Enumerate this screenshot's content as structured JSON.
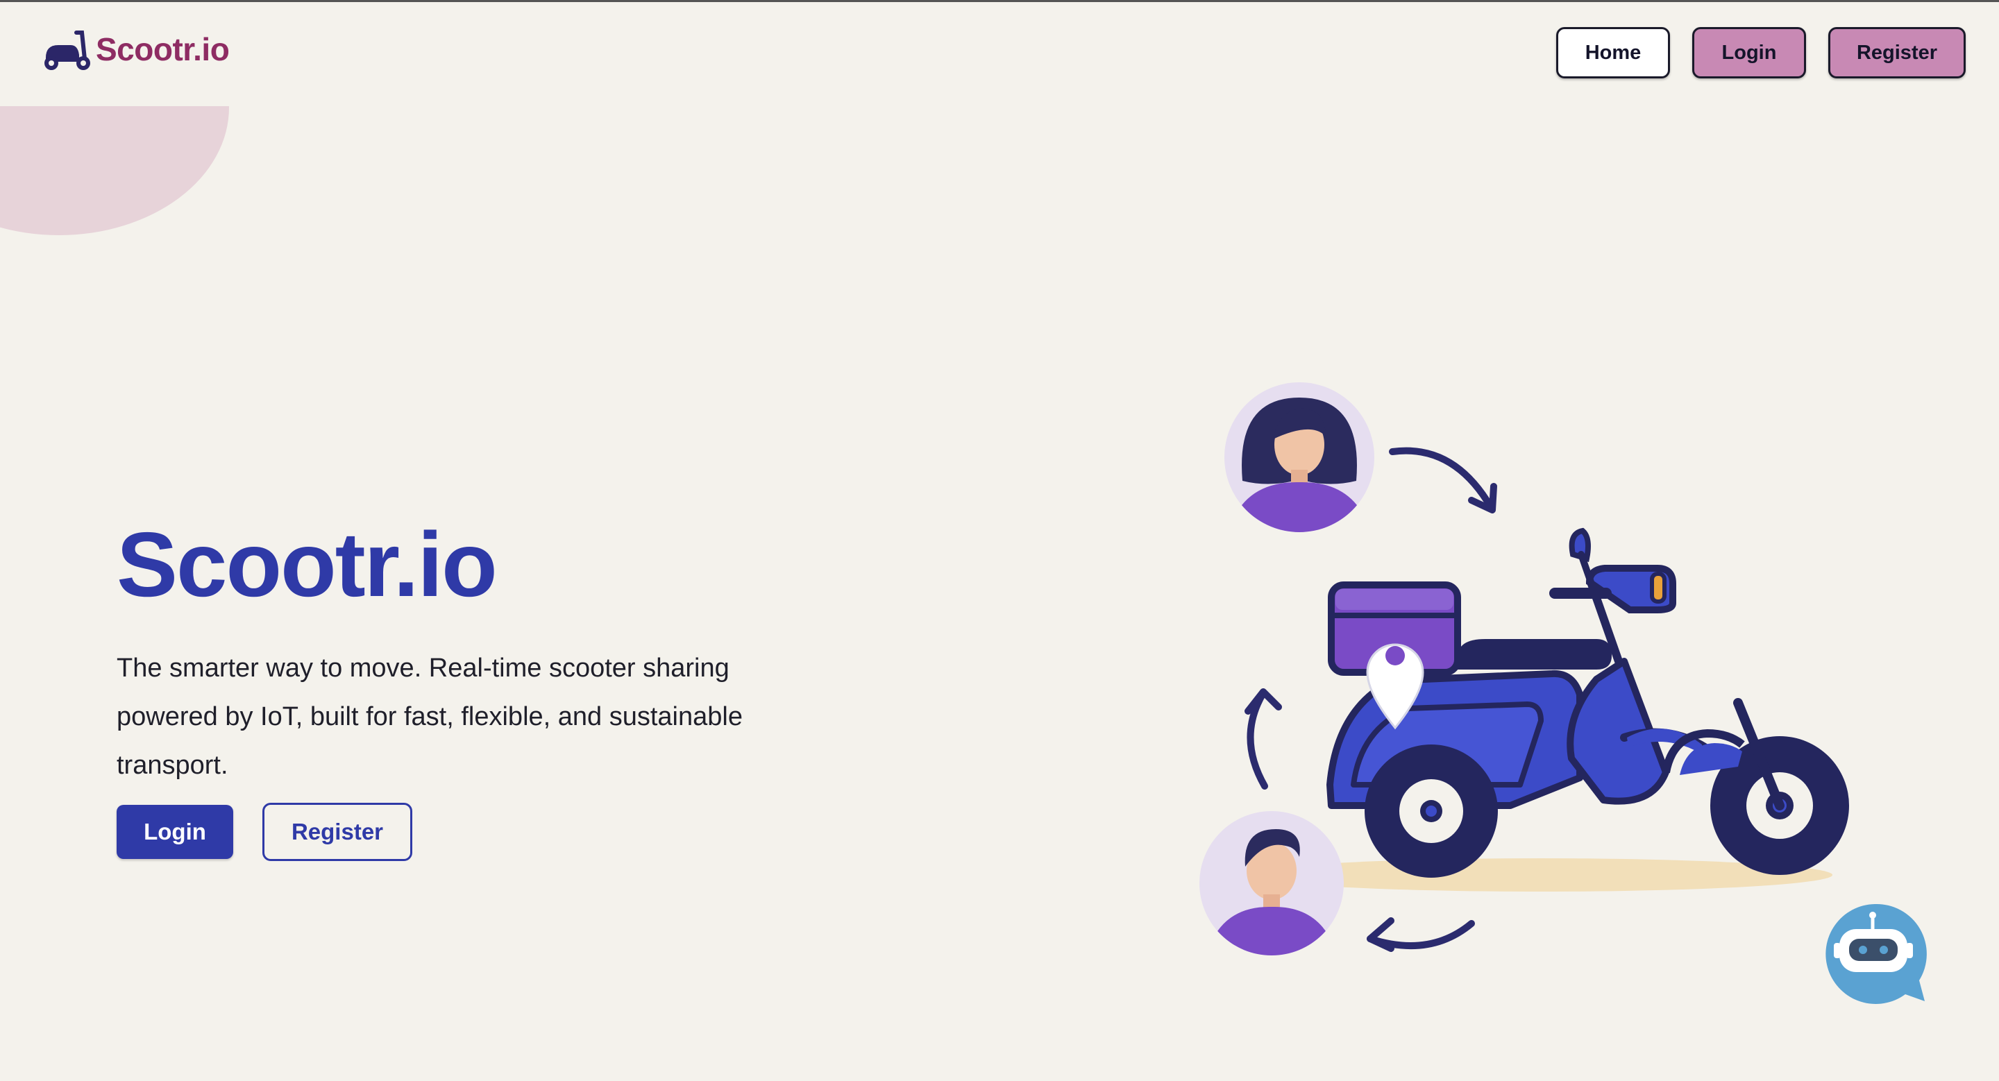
{
  "app": {
    "brand_name": "Scootr.io"
  },
  "nav": {
    "home_label": "Home",
    "login_label": "Login",
    "register_label": "Register"
  },
  "hero": {
    "title": "Scootr.io",
    "description": "The smarter way to move. Real-time scooter sharing powered by IoT, built for fast, flexible, and sustainable transport.",
    "login_label": "Login",
    "register_label": "Register"
  },
  "icons": {
    "brand": "scooter-icon",
    "chat": "chatbot-icon"
  },
  "colors": {
    "brand": "#8e2c63",
    "primary": "#2f3aa7",
    "nav_accent": "#c889b4",
    "background": "#f4f2ec",
    "chat": "#5aa2d2"
  }
}
